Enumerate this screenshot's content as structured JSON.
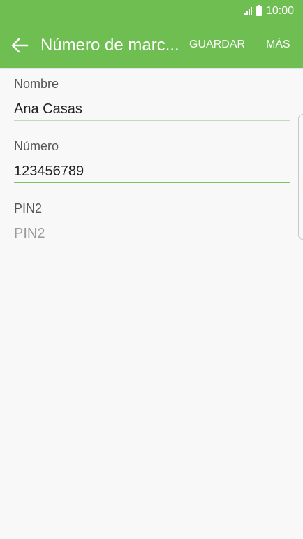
{
  "status_bar": {
    "time": "10:00",
    "icons": [
      "signal-icon",
      "battery-icon"
    ]
  },
  "app_bar": {
    "back_icon": "arrow-left-icon",
    "title": "Número de marc...",
    "save_label": "GUARDAR",
    "more_label": "MÁS"
  },
  "form": {
    "name": {
      "label": "Nombre",
      "value": "Ana Casas",
      "placeholder": ""
    },
    "number": {
      "label": "Número",
      "value": "123456789",
      "placeholder": ""
    },
    "pin2": {
      "label": "PIN2",
      "value": "",
      "placeholder": "PIN2"
    }
  },
  "colors": {
    "accent": "#6fbe52",
    "underline": "#bfdfb2",
    "underline_active": "#7cc45f",
    "background": "#f8f8f8"
  }
}
